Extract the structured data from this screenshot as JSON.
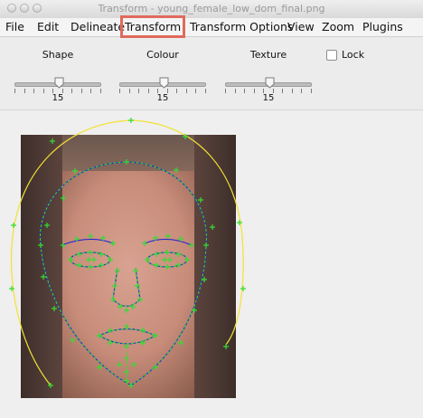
{
  "window": {
    "title": "Transform - young_female_low_dom_final.png"
  },
  "menu": {
    "items": [
      {
        "label": "File"
      },
      {
        "label": "Edit"
      },
      {
        "label": "Delineate"
      },
      {
        "label": "Transform"
      },
      {
        "label": "Transform Options"
      },
      {
        "label": "View"
      },
      {
        "label": "Zoom"
      },
      {
        "label": "Plugins"
      }
    ],
    "highlighted": "Transform"
  },
  "controls": {
    "shape": {
      "label": "Shape",
      "value": "15"
    },
    "colour": {
      "label": "Colour",
      "value": "15"
    },
    "texture": {
      "label": "Texture",
      "value": "15"
    },
    "lock": {
      "label": "Lock",
      "checked": false
    }
  },
  "colors": {
    "highlight": "#e06a5c",
    "template_points": "#33dd33",
    "outline_inner": "#2a2acc",
    "outline_outer": "#f2e233"
  }
}
